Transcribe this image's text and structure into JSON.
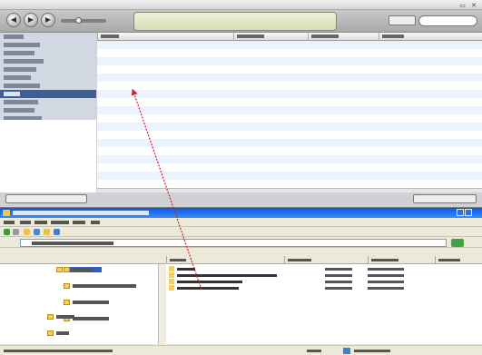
{
  "itunes": {
    "title": "",
    "lcd_logo": "",
    "search_placeholder": "",
    "source_items": [
      {
        "label": "",
        "selected": false
      },
      {
        "label": "",
        "selected": false
      },
      {
        "label": "",
        "selected": false
      },
      {
        "label": "",
        "selected": false
      },
      {
        "label": "",
        "selected": false
      },
      {
        "label": "",
        "selected": false
      },
      {
        "label": "",
        "selected": false
      },
      {
        "label": "",
        "selected": true
      },
      {
        "label": "",
        "selected": false
      },
      {
        "label": "",
        "selected": false
      },
      {
        "label": "",
        "selected": false
      }
    ],
    "artwork_text": "",
    "columns": [
      "",
      "",
      "",
      ""
    ]
  },
  "explorer": {
    "title": "",
    "menu": [
      "",
      "",
      "",
      "",
      "",
      ""
    ],
    "address": "",
    "tree_header": "",
    "tree_nodes": [
      {
        "label": "",
        "selected": true
      },
      {
        "label": "",
        "selected": false
      },
      {
        "label": "",
        "selected": false
      },
      {
        "label": "",
        "selected": false
      },
      {
        "label": "",
        "selected": false
      },
      {
        "label": "",
        "selected": false
      },
      {
        "label": "",
        "selected": false
      }
    ],
    "list_columns": [
      "",
      "",
      "",
      ""
    ],
    "files": [
      {
        "name": "",
        "size": "",
        "type": ""
      },
      {
        "name": "",
        "size": "",
        "type": ""
      },
      {
        "name": "",
        "size": "",
        "type": ""
      },
      {
        "name": "",
        "size": "",
        "type": ""
      }
    ],
    "status_left": "",
    "status_mid": "",
    "status_right": ""
  },
  "colors": {
    "drag_arrow": "#cc2222",
    "xp_title_blue": "#0a58e0",
    "itunes_selection": "#3d5f95"
  }
}
